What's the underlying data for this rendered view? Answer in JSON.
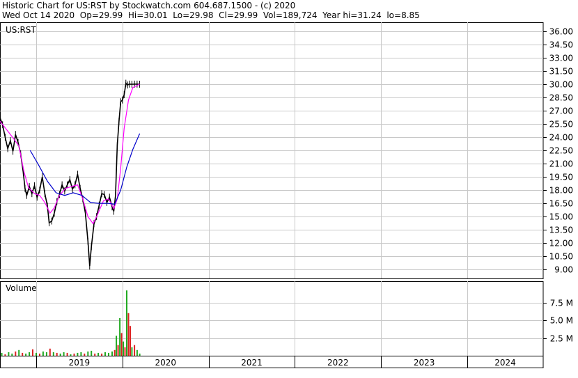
{
  "header": {
    "line1": "Historic Chart for US:RST by Stockwatch.com 604.687.1500 - (c) 2020",
    "line2": "Wed Oct 14 2020  Op=29.99  Hi=30.01  Lo=29.98  Cl=29.99  Vol=189,724  Year hi=31.24  lo=8.85"
  },
  "price_panel": {
    "label": "US:RST"
  },
  "volume_panel": {
    "label": "Volume"
  },
  "chart_data": [
    {
      "type": "line",
      "title": "US:RST",
      "y_ticks": [
        "36.00",
        "34.50",
        "33.00",
        "31.50",
        "30.00",
        "28.50",
        "27.00",
        "25.50",
        "24.00",
        "22.50",
        "21.00",
        "19.50",
        "18.00",
        "16.50",
        "15.00",
        "13.50",
        "12.00",
        "10.50",
        "9.00"
      ],
      "x_ticks": [
        "2019",
        "2020",
        "2021",
        "2022",
        "2023",
        "2024"
      ],
      "ylim": [
        8.0,
        37.0
      ],
      "xlim": [
        2018.5,
        2024.8
      ],
      "grid": true,
      "series": [
        {
          "color": "#000000",
          "style": "price",
          "points": [
            [
              2018.5,
              26.2
            ],
            [
              2018.53,
              25.4
            ],
            [
              2018.56,
              24.0
            ],
            [
              2018.59,
              22.7
            ],
            [
              2018.62,
              23.6
            ],
            [
              2018.65,
              22.4
            ],
            [
              2018.68,
              24.3
            ],
            [
              2018.71,
              23.4
            ],
            [
              2018.74,
              22.1
            ],
            [
              2018.77,
              20.0
            ],
            [
              2018.79,
              18.2
            ],
            [
              2018.81,
              17.4
            ],
            [
              2018.84,
              18.4
            ],
            [
              2018.87,
              17.6
            ],
            [
              2018.9,
              18.5
            ],
            [
              2018.93,
              17.2
            ],
            [
              2018.96,
              18.0
            ],
            [
              2018.99,
              19.5
            ],
            [
              2019.02,
              17.6
            ],
            [
              2019.05,
              16.2
            ],
            [
              2019.07,
              14.3
            ],
            [
              2019.1,
              14.5
            ],
            [
              2019.13,
              15.4
            ],
            [
              2019.16,
              16.7
            ],
            [
              2019.19,
              17.5
            ],
            [
              2019.22,
              18.6
            ],
            [
              2019.25,
              17.9
            ],
            [
              2019.28,
              18.6
            ],
            [
              2019.31,
              19.2
            ],
            [
              2019.34,
              18.1
            ],
            [
              2019.37,
              18.6
            ],
            [
              2019.4,
              19.8
            ],
            [
              2019.43,
              18.2
            ],
            [
              2019.46,
              17.0
            ],
            [
              2019.49,
              15.4
            ],
            [
              2019.52,
              12.2
            ],
            [
              2019.54,
              9.4
            ],
            [
              2019.56,
              11.6
            ],
            [
              2019.59,
              14.2
            ],
            [
              2019.62,
              15.0
            ],
            [
              2019.65,
              16.3
            ],
            [
              2019.68,
              17.6
            ],
            [
              2019.71,
              17.5
            ],
            [
              2019.74,
              16.6
            ],
            [
              2019.77,
              17.2
            ],
            [
              2019.8,
              16.1
            ],
            [
              2019.82,
              15.6
            ],
            [
              2019.84,
              17.4
            ],
            [
              2019.86,
              23.1
            ],
            [
              2019.88,
              25.8
            ],
            [
              2019.9,
              28.0
            ],
            [
              2019.92,
              28.2
            ],
            [
              2019.94,
              28.8
            ],
            [
              2019.96,
              30.1
            ],
            [
              2019.98,
              29.9
            ],
            [
              2020.0,
              30.0
            ],
            [
              2020.03,
              29.99
            ],
            [
              2020.06,
              30.0
            ],
            [
              2020.09,
              30.0
            ],
            [
              2020.12,
              29.99
            ]
          ]
        },
        {
          "color": "#ff00ff",
          "style": "ma-short",
          "points": [
            [
              2018.5,
              25.8
            ],
            [
              2018.58,
              24.8
            ],
            [
              2018.66,
              23.8
            ],
            [
              2018.72,
              23.0
            ],
            [
              2018.78,
              20.0
            ],
            [
              2018.83,
              18.3
            ],
            [
              2018.9,
              17.6
            ],
            [
              2018.96,
              17.4
            ],
            [
              2019.02,
              16.6
            ],
            [
              2019.08,
              15.4
            ],
            [
              2019.13,
              16.0
            ],
            [
              2019.19,
              17.4
            ],
            [
              2019.26,
              18.2
            ],
            [
              2019.33,
              18.4
            ],
            [
              2019.4,
              18.6
            ],
            [
              2019.46,
              17.0
            ],
            [
              2019.52,
              15.0
            ],
            [
              2019.58,
              14.2
            ],
            [
              2019.63,
              15.2
            ],
            [
              2019.7,
              16.8
            ],
            [
              2019.76,
              17.0
            ],
            [
              2019.82,
              15.9
            ],
            [
              2019.86,
              17.0
            ],
            [
              2019.9,
              20.5
            ],
            [
              2019.94,
              25.0
            ],
            [
              2019.99,
              28.2
            ],
            [
              2020.04,
              29.6
            ],
            [
              2020.12,
              30.0
            ]
          ]
        },
        {
          "color": "#0000cc",
          "style": "ma-long",
          "points": [
            [
              2018.85,
              22.5
            ],
            [
              2018.95,
              20.8
            ],
            [
              2019.05,
              19.0
            ],
            [
              2019.15,
              17.7
            ],
            [
              2019.25,
              17.4
            ],
            [
              2019.35,
              17.7
            ],
            [
              2019.45,
              17.4
            ],
            [
              2019.55,
              16.6
            ],
            [
              2019.65,
              16.5
            ],
            [
              2019.75,
              16.5
            ],
            [
              2019.83,
              16.4
            ],
            [
              2019.9,
              18.0
            ],
            [
              2019.97,
              20.6
            ],
            [
              2020.04,
              22.6
            ],
            [
              2020.12,
              24.4
            ]
          ]
        }
      ]
    },
    {
      "type": "bar",
      "title": "Volume",
      "y_ticks": [
        "7.5 M",
        "5.0 M",
        "2.5 M"
      ],
      "ylim": [
        0,
        10.0
      ],
      "unit": "M",
      "x": [
        2018.52,
        2018.56,
        2018.6,
        2018.64,
        2018.68,
        2018.72,
        2018.76,
        2018.8,
        2018.84,
        2018.88,
        2018.92,
        2018.96,
        2019.0,
        2019.04,
        2019.08,
        2019.12,
        2019.16,
        2019.2,
        2019.24,
        2019.28,
        2019.32,
        2019.36,
        2019.4,
        2019.44,
        2019.48,
        2019.52,
        2019.56,
        2019.6,
        2019.64,
        2019.68,
        2019.72,
        2019.76,
        2019.8,
        2019.83,
        2019.85,
        2019.87,
        2019.89,
        2019.91,
        2019.93,
        2019.95,
        2019.97,
        2019.99,
        2020.01,
        2020.03,
        2020.06,
        2020.09,
        2020.12
      ],
      "values": [
        0.4,
        0.2,
        0.5,
        0.3,
        0.6,
        0.8,
        0.4,
        0.3,
        0.5,
        0.9,
        0.4,
        0.3,
        0.6,
        0.5,
        1.0,
        0.5,
        0.4,
        0.3,
        0.5,
        0.4,
        0.2,
        0.3,
        0.4,
        0.5,
        0.3,
        0.6,
        0.7,
        0.3,
        0.4,
        0.3,
        0.5,
        0.4,
        0.6,
        0.8,
        2.8,
        1.5,
        5.3,
        3.2,
        2.0,
        1.2,
        9.2,
        6.0,
        4.2,
        1.2,
        1.5,
        0.8,
        0.3
      ],
      "colors": [
        "g",
        "r",
        "g",
        "g",
        "r",
        "g",
        "r",
        "g",
        "g",
        "r",
        "g",
        "r",
        "g",
        "g",
        "r",
        "g",
        "r",
        "g",
        "g",
        "r",
        "g",
        "r",
        "g",
        "g",
        "r",
        "g",
        "g",
        "r",
        "g",
        "r",
        "g",
        "g",
        "g",
        "r",
        "g",
        "r",
        "g",
        "r",
        "g",
        "r",
        "g",
        "r",
        "r",
        "g",
        "r",
        "g",
        "g"
      ]
    }
  ]
}
